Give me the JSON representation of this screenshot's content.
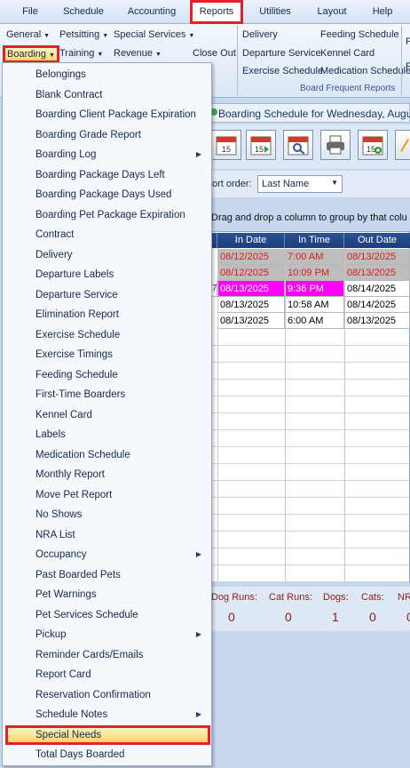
{
  "menu": {
    "items": [
      "File",
      "Schedule",
      "Accounting",
      "Reports",
      "Utilities",
      "Layout",
      "Help"
    ],
    "active": "Reports"
  },
  "ribbon": {
    "row1": [
      "General",
      "Petsitting",
      "Special Services"
    ],
    "row2": [
      "Boarding",
      "Training",
      "Revenue",
      "Close Out"
    ],
    "frequent": [
      "Delivery",
      "Feeding Schedule",
      "Departure Service",
      "Kennel Card",
      "Exercise Schedule",
      "Medication Schedule"
    ],
    "group_label": "Board Frequent Reports",
    "overflow": [
      "F",
      "F"
    ]
  },
  "schedule": {
    "title": "Boarding Schedule for Wednesday, August",
    "sort_label": "ort order:",
    "sort_value": "Last Name",
    "group_hint": "Drag and drop a column to group by that colu",
    "columns": [
      "In Date",
      "In Time",
      "Out Date"
    ],
    "rows": [
      {
        "in_date": "08/12/2025",
        "in_time": "7:00 AM",
        "out_date": "08/13/2025",
        "style": "gray-red"
      },
      {
        "in_date": "08/12/2025",
        "in_time": "10:09 PM",
        "out_date": "08/13/2025",
        "style": "gray-red"
      },
      {
        "in_date": "08/13/2025",
        "in_time": "9:36 PM",
        "out_date": "08/14/2025",
        "style": "magenta",
        "prefix": "7"
      },
      {
        "in_date": "08/13/2025",
        "in_time": "10:58 AM",
        "out_date": "08/14/2025",
        "style": "plain"
      },
      {
        "in_date": "08/13/2025",
        "in_time": "6:00 AM",
        "out_date": "08/13/2025",
        "style": "plain"
      }
    ],
    "stats": [
      {
        "label": "Dog Runs:",
        "value": "0"
      },
      {
        "label": "Cat Runs:",
        "value": "0"
      },
      {
        "label": "Dogs:",
        "value": "1"
      },
      {
        "label": "Cats:",
        "value": "0"
      },
      {
        "label": "NR",
        "value": "0"
      }
    ]
  },
  "dropdown": {
    "items": [
      {
        "label": "Belongings"
      },
      {
        "label": "Blank Contract"
      },
      {
        "label": "Boarding Client Package Expiration"
      },
      {
        "label": "Boarding Grade Report"
      },
      {
        "label": "Boarding Log",
        "submenu": true
      },
      {
        "label": "Boarding Package Days Left"
      },
      {
        "label": "Boarding Package Days Used"
      },
      {
        "label": "Boarding Pet Package Expiration"
      },
      {
        "label": "Contract"
      },
      {
        "label": "Delivery"
      },
      {
        "label": "Departure Labels"
      },
      {
        "label": "Departure Service"
      },
      {
        "label": "Elimination Report"
      },
      {
        "label": "Exercise Schedule"
      },
      {
        "label": "Exercise Timings"
      },
      {
        "label": "Feeding Schedule"
      },
      {
        "label": "First-Time Boarders"
      },
      {
        "label": "Kennel Card"
      },
      {
        "label": "Labels"
      },
      {
        "label": "Medication Schedule"
      },
      {
        "label": "Monthly Report"
      },
      {
        "label": "Move Pet Report"
      },
      {
        "label": "No Shows"
      },
      {
        "label": "NRA List"
      },
      {
        "label": "Occupancy",
        "submenu": true
      },
      {
        "label": "Past Boarded Pets"
      },
      {
        "label": "Pet Warnings"
      },
      {
        "label": "Pet Services Schedule"
      },
      {
        "label": "Pickup",
        "submenu": true
      },
      {
        "label": "Reminder Cards/Emails"
      },
      {
        "label": "Report Card"
      },
      {
        "label": "Reservation Confirmation"
      },
      {
        "label": "Schedule Notes",
        "submenu": true
      },
      {
        "label": "Special Needs",
        "highlighted": true
      },
      {
        "label": "Total Days Boarded"
      }
    ]
  },
  "colors": {
    "highlight_border": "#e0202a",
    "header_blue": "#1d3d78",
    "past_row_red": "#d42020",
    "magenta_row": "#ff00ff",
    "stat_red": "#8a1c1c"
  }
}
